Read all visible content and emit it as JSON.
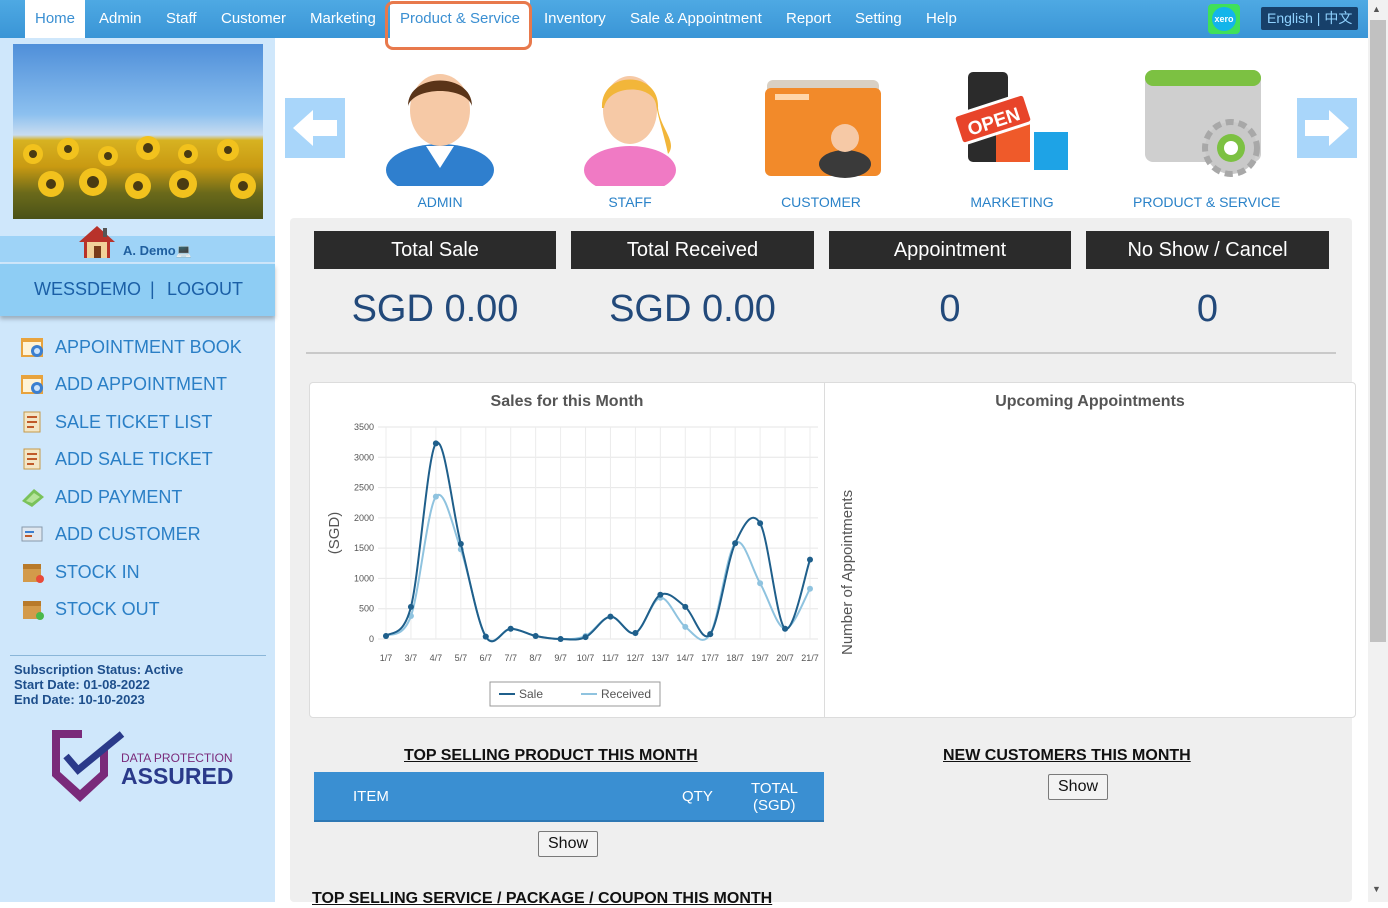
{
  "nav": {
    "items": [
      "Home",
      "Admin",
      "Staff",
      "Customer",
      "Marketing",
      "Product & Service",
      "Inventory",
      "Sale & Appointment",
      "Report",
      "Setting",
      "Help"
    ],
    "language": "English | 中文",
    "xero_label": "xero"
  },
  "sidebar": {
    "user_name": "A. Demo",
    "account_name": "WESSDEMO",
    "separator": "|",
    "logout": "LOGOUT",
    "menu": [
      "APPOINTMENT BOOK",
      "ADD APPOINTMENT",
      "SALE TICKET LIST",
      "ADD SALE TICKET",
      "ADD PAYMENT",
      "ADD CUSTOMER",
      "STOCK IN",
      "STOCK OUT"
    ],
    "subscription": {
      "status": "Subscription Status: Active",
      "start": "Start Date: 01-08-2022",
      "end": "End Date: 10-10-2023"
    },
    "badge": {
      "line1": "DATA PROTECTION",
      "line2": "ASSURED"
    }
  },
  "carousel": {
    "items": [
      "ADMIN",
      "STAFF",
      "CUSTOMER",
      "MARKETING",
      "PRODUCT & SERVICE"
    ],
    "marketing_sign": "OPEN"
  },
  "stats": {
    "headers": [
      "Total Sale",
      "Total Received",
      "Appointment",
      "No Show / Cancel"
    ],
    "values": [
      "SGD 0.00",
      "SGD 0.00",
      "0",
      "0"
    ]
  },
  "chart_data": {
    "type": "line",
    "title": "Sales for this Month",
    "ylabel": "(SGD)",
    "xlabel": "",
    "ylim": [
      0,
      3500
    ],
    "yticks": [
      0,
      500,
      1000,
      1500,
      2000,
      2500,
      3000,
      3500
    ],
    "x": [
      "1/7",
      "3/7",
      "4/7",
      "5/7",
      "6/7",
      "7/7",
      "8/7",
      "9/7",
      "10/7",
      "11/7",
      "12/7",
      "13/7",
      "14/7",
      "17/7",
      "18/7",
      "19/7",
      "20/7",
      "21/7"
    ],
    "series": [
      {
        "name": "Sale",
        "color": "#1f5f8b",
        "values": [
          50,
          530,
          3230,
          1570,
          40,
          170,
          50,
          0,
          30,
          370,
          100,
          730,
          530,
          80,
          1580,
          1910,
          170,
          1310
        ]
      },
      {
        "name": "Received",
        "color": "#8fc3df",
        "values": [
          50,
          380,
          2350,
          1480,
          40,
          170,
          50,
          0,
          50,
          370,
          100,
          680,
          200,
          80,
          1580,
          920,
          170,
          830
        ]
      }
    ],
    "legend": "bottom",
    "grid": true
  },
  "appointments": {
    "title": "Upcoming Appointments",
    "ylabel": "Number of Appointments"
  },
  "top_products": {
    "title": "TOP SELLING PRODUCT THIS MONTH",
    "columns": [
      "ITEM",
      "QTY",
      "TOTAL",
      "(SGD)"
    ],
    "show_label": "Show"
  },
  "new_customers": {
    "title": "NEW CUSTOMERS THIS MONTH",
    "show_label": "Show"
  },
  "top_services": {
    "title": "TOP SELLING SERVICE / PACKAGE / COUPON THIS MONTH"
  }
}
